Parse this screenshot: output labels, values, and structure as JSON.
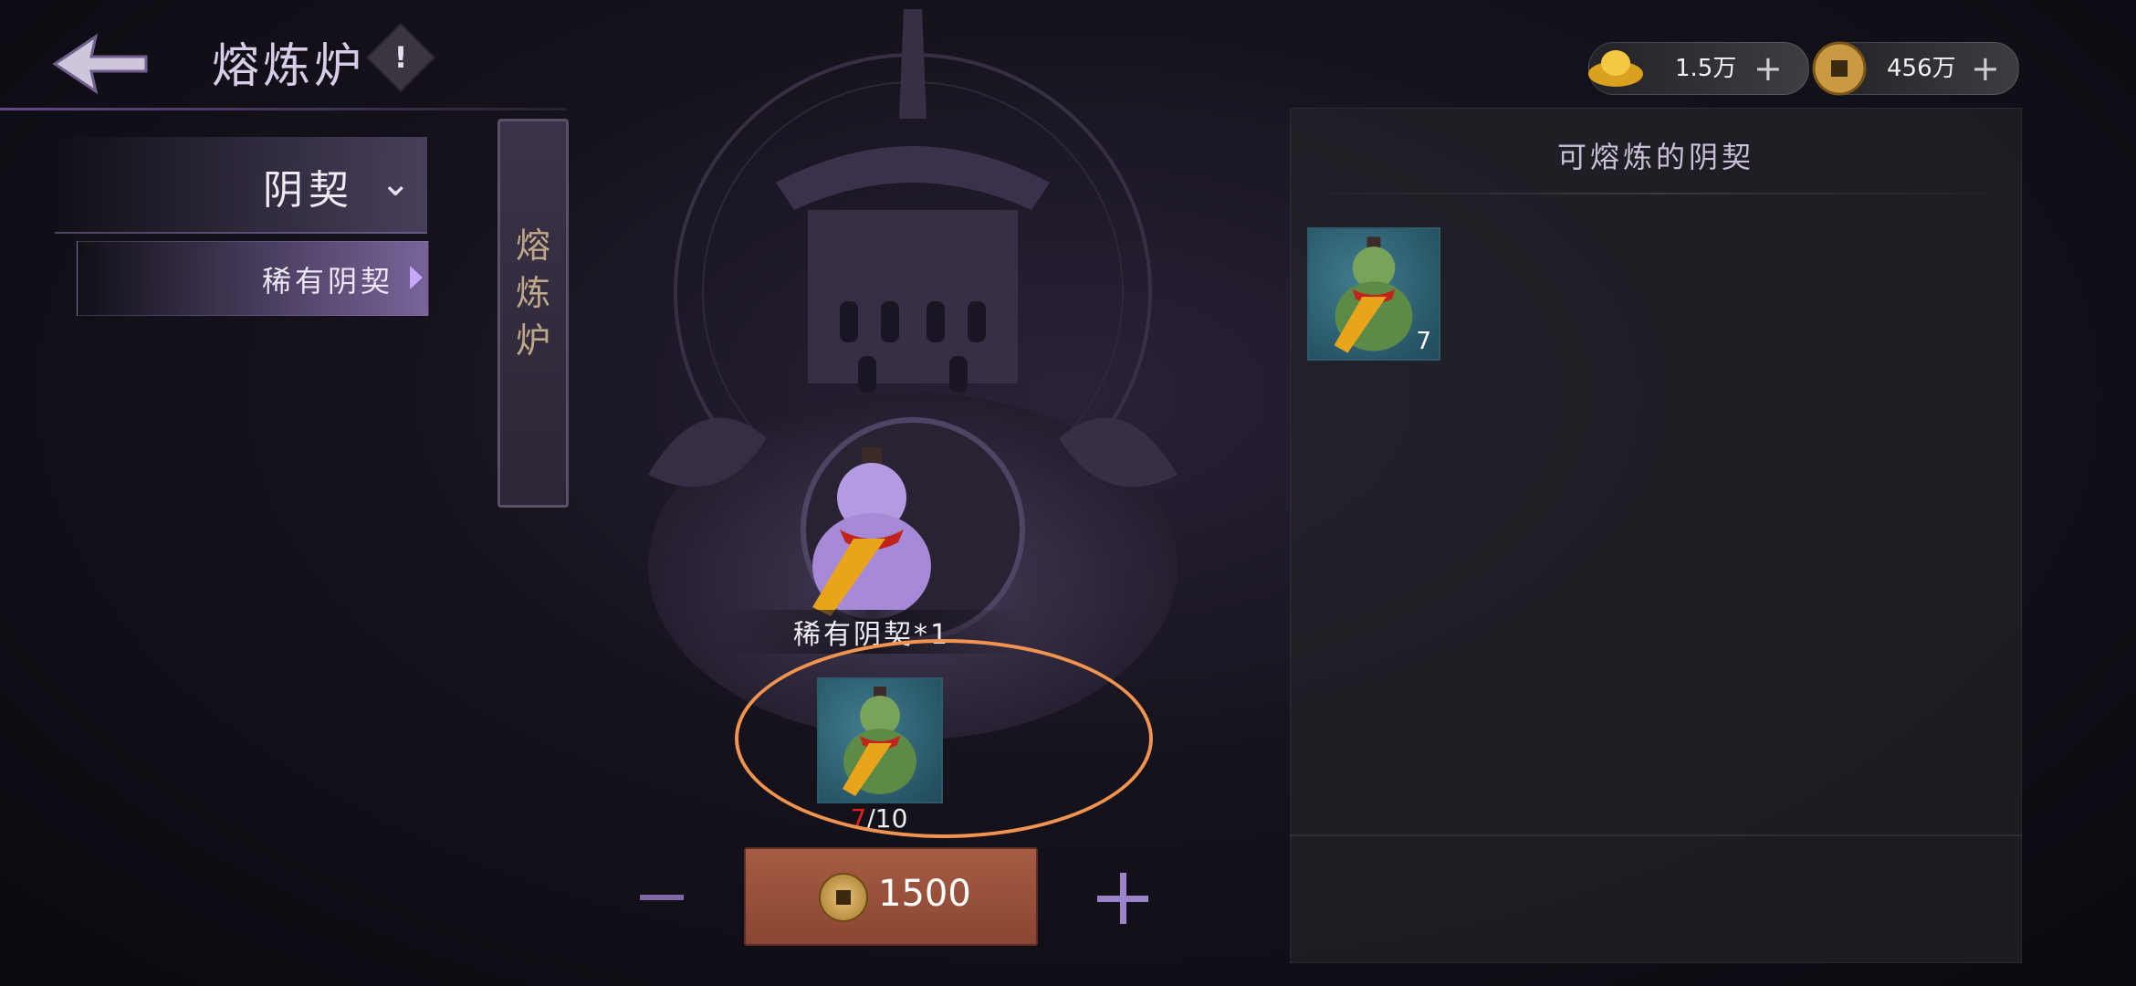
{
  "header": {
    "title": "熔炼炉",
    "info_symbol": "!"
  },
  "currencies": [
    {
      "icon": "gold-ingot-icon",
      "value": "1.5万",
      "add": "+"
    },
    {
      "icon": "copper-coin-icon",
      "value": "456万",
      "add": "+"
    }
  ],
  "sidebar": {
    "category": "阴契",
    "subcategory": "稀有阴契"
  },
  "banner": {
    "text": "熔炼炉"
  },
  "output": {
    "label": "稀有阴契*1"
  },
  "slot": {
    "current": "7",
    "required": "/10"
  },
  "controls": {
    "cost": "1500"
  },
  "right_panel": {
    "title": "可熔炼的阴契",
    "items": [
      {
        "count": "7"
      }
    ]
  },
  "colors": {
    "accent": "#8a4633",
    "highlight": "#f2944f",
    "count_warning": "#e0211c"
  }
}
